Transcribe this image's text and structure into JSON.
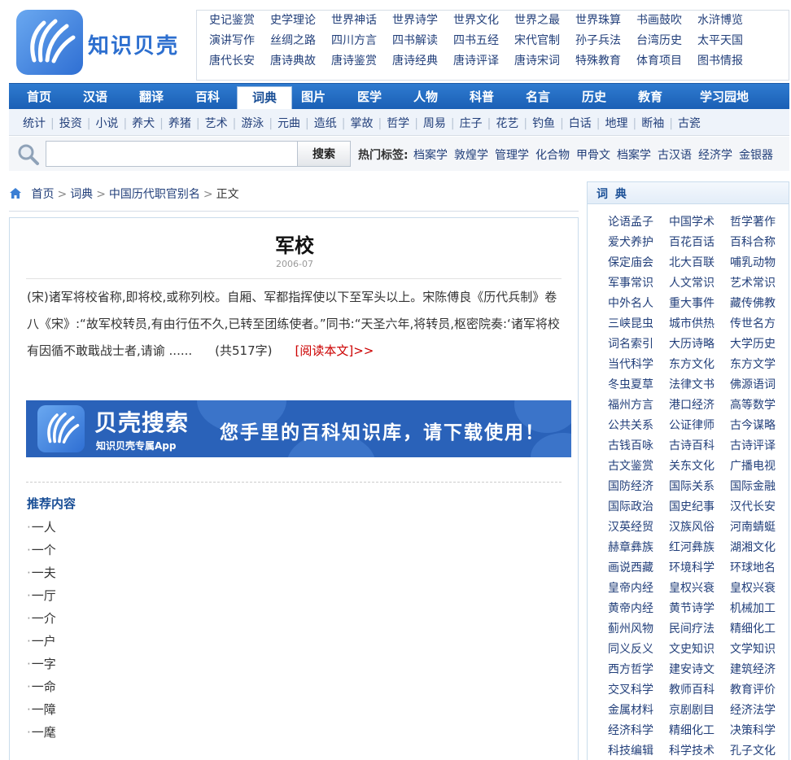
{
  "logo": {
    "text": "知识贝壳"
  },
  "top_links": [
    "史记鉴赏",
    "史学理论",
    "世界神话",
    "世界诗学",
    "世界文化",
    "世界之最",
    "世界珠算",
    "书画鼓吹",
    "水浒博览",
    "演讲写作",
    "丝绸之路",
    "四川方言",
    "四书解读",
    "四书五经",
    "宋代官制",
    "孙子兵法",
    "台湾历史",
    "太平天国",
    "唐代长安",
    "唐诗典故",
    "唐诗鉴赏",
    "唐诗经典",
    "唐诗评译",
    "唐诗宋词",
    "特殊教育",
    "体育项目",
    "图书情报"
  ],
  "main_nav": [
    {
      "label": "首页"
    },
    {
      "label": "汉语"
    },
    {
      "label": "翻译"
    },
    {
      "label": "百科"
    },
    {
      "label": "词典",
      "active": true
    },
    {
      "label": "图片"
    },
    {
      "label": "医学"
    },
    {
      "label": "人物"
    },
    {
      "label": "科普"
    },
    {
      "label": "名言"
    },
    {
      "label": "历史"
    },
    {
      "label": "教育"
    },
    {
      "label": "学习园地"
    }
  ],
  "sub_nav": [
    "统计",
    "投资",
    "小说",
    "养犬",
    "养猪",
    "艺术",
    "游泳",
    "元曲",
    "造纸",
    "掌故",
    "哲学",
    "周易",
    "庄子",
    "花艺",
    "钓鱼",
    "白话",
    "地理",
    "断袖",
    "古瓷"
  ],
  "search": {
    "placeholder": "",
    "button_label": "搜索",
    "hot_label": "热门标签:",
    "hot_tags": [
      "档案学",
      "敦煌学",
      "管理学",
      "化合物",
      "甲骨文",
      "档案学",
      "古汉语",
      "经济学",
      "金银器"
    ]
  },
  "breadcrumb": {
    "home": "首页",
    "section": "词典",
    "category": "中国历代职官别名",
    "current": "正文"
  },
  "article": {
    "title": "军校",
    "date": "2006-07",
    "body": "(宋)诸军将校省称,即将校,或称列校。自厢、军都指挥使以下至军头以上。宋陈傅良《历代兵制》卷八《宋》:“故军校转员,有由行伍不久,已转至团练使者。”同书:“天圣六年,将转员,枢密院奏:‘诸军将校有因循不敢戢战士者,请谕 ......",
    "count": "(共517字)",
    "read_more": "[阅读本文]>>"
  },
  "banner": {
    "title": "贝壳搜索",
    "subtitle": "知识贝壳专属App",
    "slogan": "您手里的百科知识库，请下载使用！"
  },
  "recommend": {
    "title": "推荐内容",
    "items": [
      "一人",
      "一个",
      "一夫",
      "一厅",
      "一介",
      "一户",
      "一字",
      "一命",
      "一障",
      "一麾"
    ]
  },
  "sidebar": {
    "title": "词 典",
    "items": [
      "论语孟子",
      "中国学术",
      "哲学著作",
      "爱犬养护",
      "百花百话",
      "百科合称",
      "保定庙会",
      "北大百联",
      "哺乳动物",
      "军事常识",
      "人文常识",
      "艺术常识",
      "中外名人",
      "重大事件",
      "藏传佛教",
      "三峡昆虫",
      "城市供热",
      "传世名方",
      "词名索引",
      "大历诗略",
      "大学历史",
      "当代科学",
      "东方文化",
      "东方文学",
      "冬虫夏草",
      "法律文书",
      "佛源语词",
      "福州方言",
      "港口经济",
      "高等数学",
      "公共关系",
      "公证律师",
      "古今谋略",
      "古钱百咏",
      "古诗百科",
      "古诗评译",
      "古文鉴赏",
      "关东文化",
      "广播电视",
      "国防经济",
      "国际关系",
      "国际金融",
      "国际政治",
      "国史纪事",
      "汉代长安",
      "汉英经贸",
      "汉族风俗",
      "河南蜻蜓",
      "赫章彝族",
      "红河彝族",
      "湖湘文化",
      "画说西藏",
      "环境科学",
      "环球地名",
      "皇帝内经",
      "皇权兴衰",
      "皇权兴衰",
      "黄帝内经",
      "黄节诗学",
      "机械加工",
      "蓟州风物",
      "民间疗法",
      "精细化工",
      "同义反义",
      "文史知识",
      "文学知识",
      "西方哲学",
      "建安诗文",
      "建筑经济",
      "交叉科学",
      "教师百科",
      "教育评价",
      "金属材料",
      "京剧剧目",
      "经济法学",
      "经济科学",
      "精细化工",
      "决策科学",
      "科技编辑",
      "科学技术",
      "孔子文化"
    ]
  }
}
